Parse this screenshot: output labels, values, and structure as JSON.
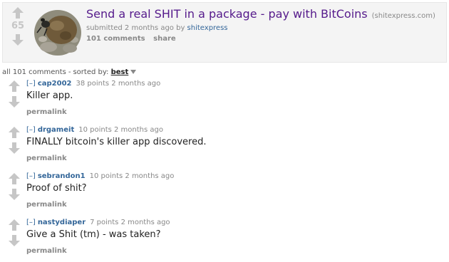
{
  "colors": {
    "arrow": "#c6c6c6",
    "title_link": "#551a8b",
    "author_link": "#369",
    "meta_text": "#888"
  },
  "post": {
    "score": "65",
    "title": "Send a real SHIT in a package - pay with BitCoins",
    "domain": "(shitexpress.com)",
    "submitted_prefix": "submitted 2 months ago by",
    "author": "shitexpress",
    "comments_label": "101 comments",
    "share_label": "share",
    "thumbnail_icon": "dung-beetle-thumbnail"
  },
  "sort_bar": {
    "all_comments": "all 101 comments",
    "separator": "-",
    "sorted_by": "sorted by:",
    "sort_value": "best"
  },
  "comments": [
    {
      "toggle": "[–]",
      "author": "cap2002",
      "points_time": "38 points 2 months ago",
      "body": "Killer app.",
      "permalink": "permalink"
    },
    {
      "toggle": "[–]",
      "author": "drgameit",
      "points_time": "10 points 2 months ago",
      "body": "FINALLY bitcoin's killer app discovered.",
      "permalink": "permalink"
    },
    {
      "toggle": "[–]",
      "author": "sebrandon1",
      "points_time": "10 points 2 months ago",
      "body": "Proof of shit?",
      "permalink": "permalink"
    },
    {
      "toggle": "[–]",
      "author": "nastydiaper",
      "points_time": "7 points 2 months ago",
      "body": "Give a Shit (tm) - was taken?",
      "permalink": "permalink"
    }
  ]
}
